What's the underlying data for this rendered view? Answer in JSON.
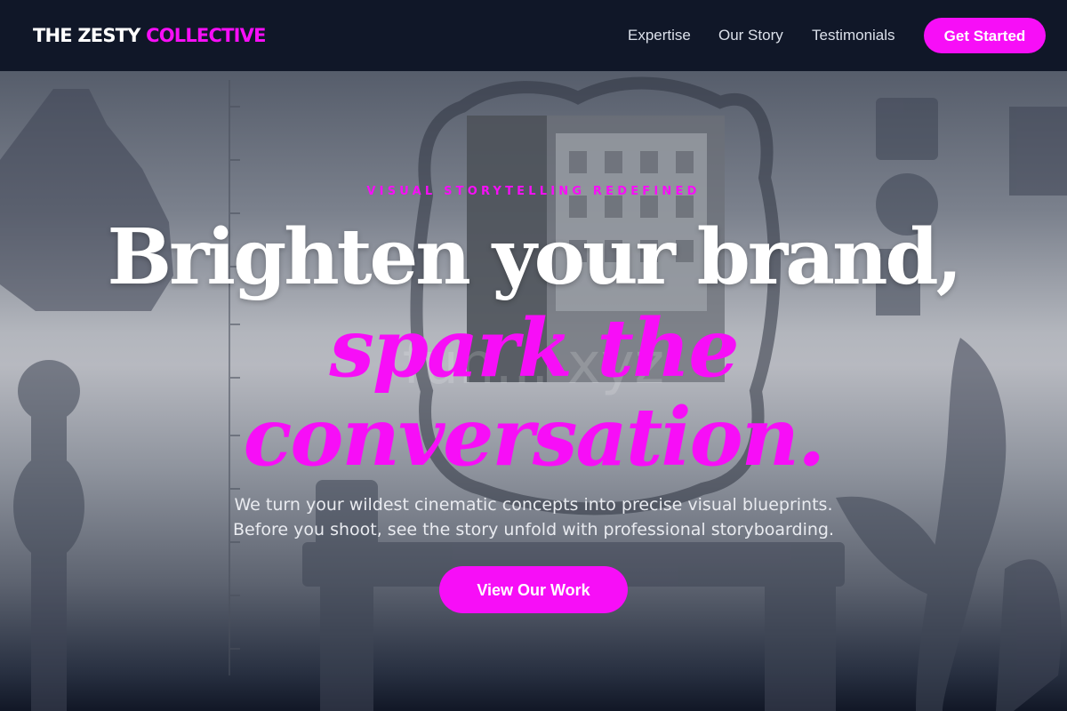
{
  "nav": {
    "brand_primary": "THE ZESTY",
    "brand_accent": "COLLECTIVE",
    "links": [
      "Expertise",
      "Our Story",
      "Testimonials"
    ],
    "cta_label": "Get Started"
  },
  "hero": {
    "eyebrow": "VISUAL STORYTELLING REDEFINED",
    "headline_line1": "Brighten your brand,",
    "headline_accent_line1": "spark the",
    "headline_accent_line2": "conversation.",
    "subtext_line1": "We turn your wildest cinematic concepts into precise visual blueprints.",
    "subtext_line2": "Before you shoot, see the story unfold with professional storyboarding.",
    "cta_label": "View Our Work",
    "watermark": "fun... xyz"
  },
  "colors": {
    "accent": "#f70ef7",
    "nav_bg": "#101728",
    "text_light": "#ffffff"
  },
  "icons": {
    "background": "sketch-illustration-background"
  }
}
